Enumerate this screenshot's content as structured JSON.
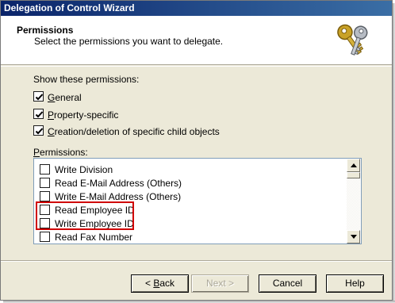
{
  "window": {
    "title": "Delegation of Control Wizard"
  },
  "header": {
    "title": "Permissions",
    "subtitle": "Select the permissions you want to delegate.",
    "icon": "keys-icon"
  },
  "show_permissions": {
    "label": "Show these permissions:",
    "options": [
      {
        "mnemonic": "G",
        "rest": "eneral",
        "checked": true
      },
      {
        "mnemonic": "P",
        "rest": "roperty-specific",
        "checked": true
      },
      {
        "mnemonic": "C",
        "rest": "reation/deletion of specific child objects",
        "checked": true
      }
    ]
  },
  "permissions": {
    "label_mnemonic": "P",
    "label_rest": "ermissions:",
    "items": [
      {
        "label": "Write Division",
        "checked": false
      },
      {
        "label": "Read E-Mail Address (Others)",
        "checked": false
      },
      {
        "label": "Write E-Mail Address (Others)",
        "checked": false
      },
      {
        "label": "Read Employee ID",
        "checked": false
      },
      {
        "label": "Write Employee ID",
        "checked": false
      },
      {
        "label": "Read Fax Number",
        "checked": false
      }
    ]
  },
  "buttons": {
    "back_prefix": "< ",
    "back_mnemonic": "B",
    "back_rest": "ack",
    "next": "Next >",
    "cancel": "Cancel",
    "help": "Help"
  },
  "colors": {
    "highlight_box": "#d00000",
    "title_bar": "#0a246a"
  }
}
